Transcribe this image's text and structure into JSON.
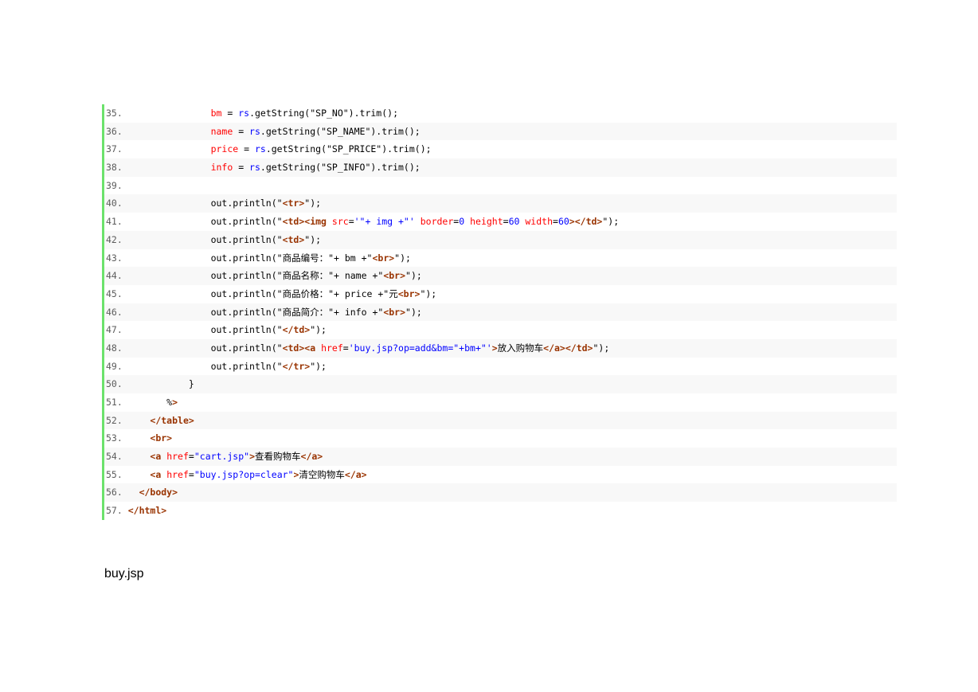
{
  "code": {
    "lines": [
      {
        "num": "35.",
        "indent": "               ",
        "tokens": [
          [
            "var",
            "bm"
          ],
          [
            "plain",
            " = "
          ],
          [
            "obj",
            "rs"
          ],
          [
            "plain",
            ".getString(\"SP_NO\").trim();"
          ]
        ]
      },
      {
        "num": "36.",
        "indent": "               ",
        "tokens": [
          [
            "var",
            "name"
          ],
          [
            "plain",
            " = "
          ],
          [
            "obj",
            "rs"
          ],
          [
            "plain",
            ".getString(\"SP_NAME\").trim();"
          ]
        ]
      },
      {
        "num": "37.",
        "indent": "               ",
        "tokens": [
          [
            "var",
            "price"
          ],
          [
            "plain",
            " = "
          ],
          [
            "obj",
            "rs"
          ],
          [
            "plain",
            ".getString(\"SP_PRICE\").trim();"
          ]
        ]
      },
      {
        "num": "38.",
        "indent": "               ",
        "tokens": [
          [
            "var",
            "info"
          ],
          [
            "plain",
            " = "
          ],
          [
            "obj",
            "rs"
          ],
          [
            "plain",
            ".getString(\"SP_INFO\").trim();"
          ]
        ]
      },
      {
        "num": "39.",
        "indent": "",
        "tokens": []
      },
      {
        "num": "40.",
        "indent": "               ",
        "tokens": [
          [
            "plain",
            "out.println(\""
          ],
          [
            "tag",
            "<tr>"
          ],
          [
            "plain",
            "\");"
          ]
        ]
      },
      {
        "num": "41.",
        "indent": "               ",
        "tokens": [
          [
            "plain",
            "out.println(\""
          ],
          [
            "tag",
            "<td><img"
          ],
          [
            "plain",
            " "
          ],
          [
            "attr",
            "src"
          ],
          [
            "plain",
            "="
          ],
          [
            "val",
            "'\"+ img +\"'"
          ],
          [
            "plain",
            " "
          ],
          [
            "attr",
            "border"
          ],
          [
            "plain",
            "="
          ],
          [
            "val",
            "0"
          ],
          [
            "plain",
            " "
          ],
          [
            "attr",
            "height"
          ],
          [
            "plain",
            "="
          ],
          [
            "val",
            "60"
          ],
          [
            "plain",
            " "
          ],
          [
            "attr",
            "width"
          ],
          [
            "plain",
            "="
          ],
          [
            "val",
            "60"
          ],
          [
            "tag",
            "></td>"
          ],
          [
            "plain",
            "\");"
          ]
        ]
      },
      {
        "num": "42.",
        "indent": "               ",
        "tokens": [
          [
            "plain",
            "out.println(\""
          ],
          [
            "tag",
            "<td>"
          ],
          [
            "plain",
            "\");"
          ]
        ]
      },
      {
        "num": "43.",
        "indent": "               ",
        "tokens": [
          [
            "plain",
            "out.println(\"商品编号：\"+ bm +\""
          ],
          [
            "tag",
            "<br>"
          ],
          [
            "plain",
            "\");"
          ]
        ]
      },
      {
        "num": "44.",
        "indent": "               ",
        "tokens": [
          [
            "plain",
            "out.println(\"商品名称：\"+ name +\""
          ],
          [
            "tag",
            "<br>"
          ],
          [
            "plain",
            "\");"
          ]
        ]
      },
      {
        "num": "45.",
        "indent": "               ",
        "tokens": [
          [
            "plain",
            "out.println(\"商品价格：\"+ price +\"元"
          ],
          [
            "tag",
            "<br>"
          ],
          [
            "plain",
            "\");"
          ]
        ]
      },
      {
        "num": "46.",
        "indent": "               ",
        "tokens": [
          [
            "plain",
            "out.println(\"商品简介：\"+ info +\""
          ],
          [
            "tag",
            "<br>"
          ],
          [
            "plain",
            "\");"
          ]
        ]
      },
      {
        "num": "47.",
        "indent": "               ",
        "tokens": [
          [
            "plain",
            "out.println(\""
          ],
          [
            "tag",
            "</td>"
          ],
          [
            "plain",
            "\");"
          ]
        ]
      },
      {
        "num": "48.",
        "indent": "               ",
        "tokens": [
          [
            "plain",
            "out.println(\""
          ],
          [
            "tag",
            "<td><a"
          ],
          [
            "plain",
            " "
          ],
          [
            "attr",
            "href"
          ],
          [
            "plain",
            "="
          ],
          [
            "val",
            "'buy.jsp?op=add&bm=\"+bm+\"'"
          ],
          [
            "tag",
            ">"
          ],
          [
            "plain",
            "放入购物车"
          ],
          [
            "tag",
            "</a></td>"
          ],
          [
            "plain",
            "\");"
          ]
        ]
      },
      {
        "num": "49.",
        "indent": "               ",
        "tokens": [
          [
            "plain",
            "out.println(\""
          ],
          [
            "tag",
            "</tr>"
          ],
          [
            "plain",
            "\");"
          ]
        ]
      },
      {
        "num": "50.",
        "indent": "           ",
        "tokens": [
          [
            "plain",
            "}"
          ]
        ]
      },
      {
        "num": "51.",
        "indent": "       ",
        "tokens": [
          [
            "plain",
            "%"
          ],
          [
            "tag",
            ">"
          ]
        ]
      },
      {
        "num": "52.",
        "indent": "    ",
        "tokens": [
          [
            "tag",
            "</table>"
          ]
        ]
      },
      {
        "num": "53.",
        "indent": "    ",
        "tokens": [
          [
            "tag",
            "<br>"
          ]
        ]
      },
      {
        "num": "54.",
        "indent": "    ",
        "tokens": [
          [
            "tag",
            "<a"
          ],
          [
            "plain",
            " "
          ],
          [
            "attr",
            "href"
          ],
          [
            "plain",
            "="
          ],
          [
            "val",
            "\"cart.jsp\""
          ],
          [
            "tag",
            ">"
          ],
          [
            "plain",
            "查看购物车"
          ],
          [
            "tag",
            "</a>"
          ]
        ]
      },
      {
        "num": "55.",
        "indent": "    ",
        "tokens": [
          [
            "tag",
            "<a"
          ],
          [
            "plain",
            " "
          ],
          [
            "attr",
            "href"
          ],
          [
            "plain",
            "="
          ],
          [
            "val",
            "\"buy.jsp?op=clear\""
          ],
          [
            "tag",
            ">"
          ],
          [
            "plain",
            "清空购物车"
          ],
          [
            "tag",
            "</a>"
          ]
        ]
      },
      {
        "num": "56.",
        "indent": "  ",
        "tokens": [
          [
            "tag",
            "</body>"
          ]
        ]
      },
      {
        "num": "57.",
        "indent": "",
        "tokens": [
          [
            "tag",
            "</html>"
          ]
        ]
      }
    ]
  },
  "file_label": "buy.jsp"
}
